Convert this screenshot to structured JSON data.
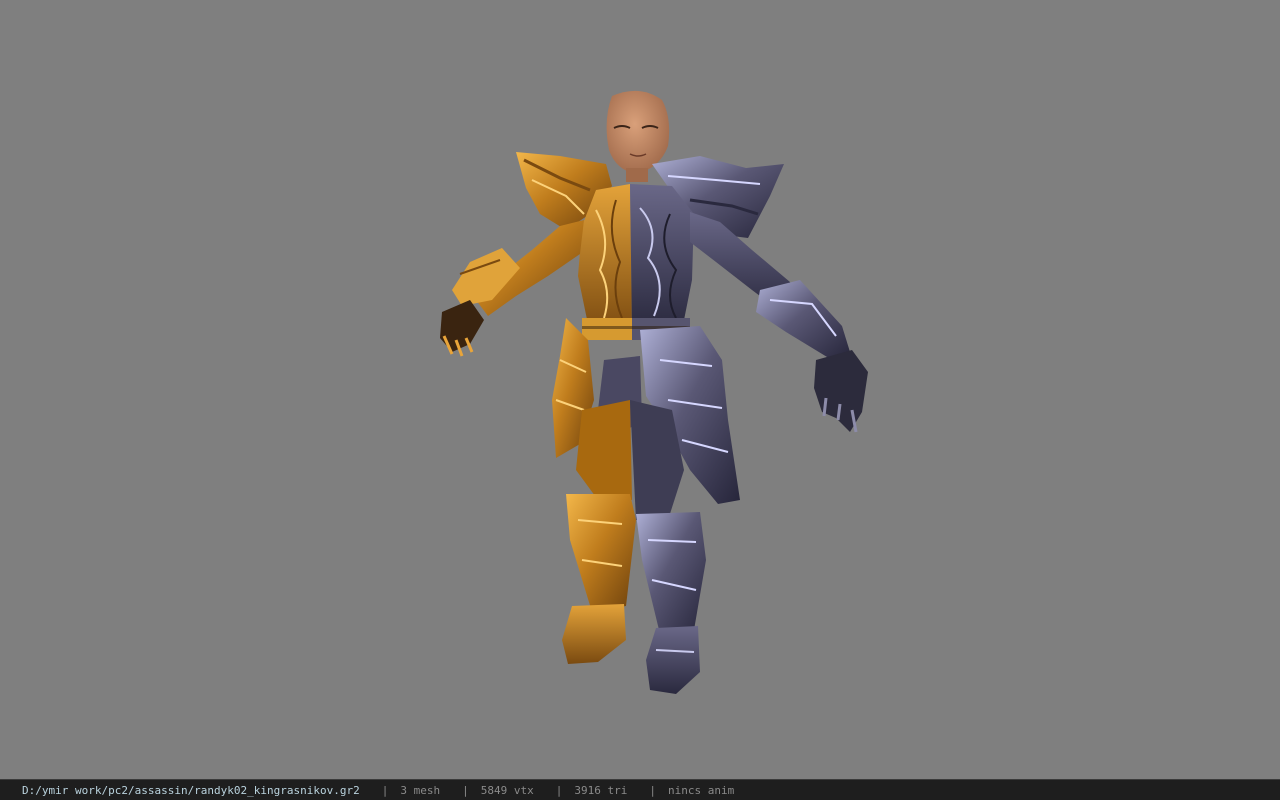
{
  "viewport": {
    "background": "#7f7f7f",
    "model_name": "randyk02_kingrasnikov"
  },
  "statusbar": {
    "file_path": "D:/ymir work/pc2/assassin/randyk02_kingrasnikov.gr2",
    "separator": "|",
    "mesh_count": "3 mesh",
    "vertex_count": "5849 vtx",
    "triangle_count": "3916 tri",
    "animation": "nincs anim"
  },
  "colors": {
    "gold_armor": "#c8861c",
    "silver_armor": "#5c5a78",
    "skin": "#c98d6a",
    "statusbar_bg": "#1e1e1e",
    "path_text": "#b9d2dd",
    "stat_text": "#8a8a8a"
  }
}
